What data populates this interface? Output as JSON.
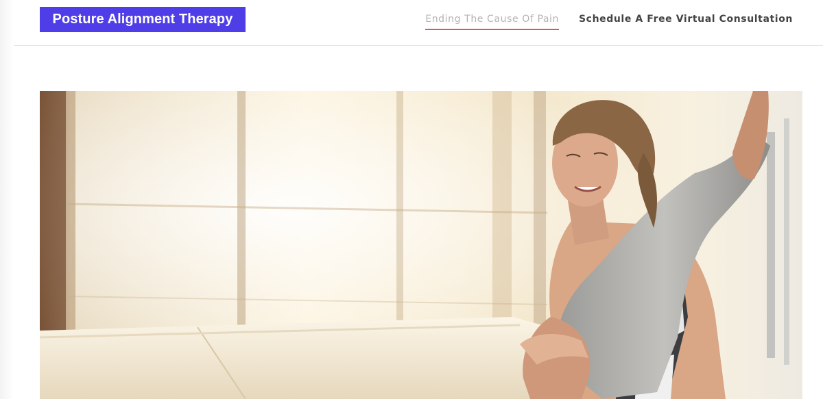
{
  "brand": {
    "logo_text": "Posture Alignment Therapy",
    "color": "#4f3ee8"
  },
  "nav": {
    "items": [
      {
        "label": "Ending The Cause Of Pain",
        "active": true
      },
      {
        "label": "Schedule A Free Virtual Consultation",
        "active": false
      }
    ],
    "active_underline_color": "#e4574c"
  },
  "hero": {
    "image_icon": "stretching-woman-photo"
  }
}
